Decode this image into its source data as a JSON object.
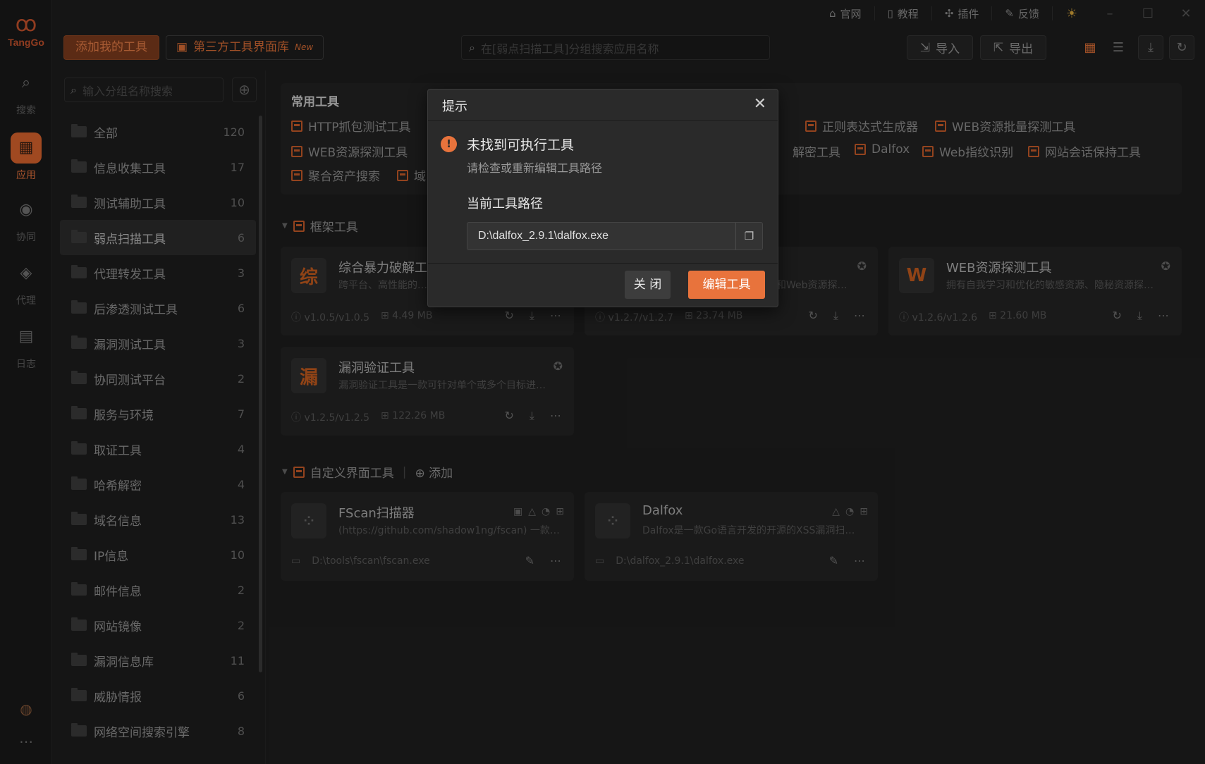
{
  "app": {
    "logo_text": "TangGo"
  },
  "rail": [
    {
      "label": "搜索",
      "icon": "search-icon"
    },
    {
      "label": "应用",
      "icon": "apps-icon",
      "active": true
    },
    {
      "label": "协同",
      "icon": "collab-icon"
    },
    {
      "label": "代理",
      "icon": "proxy-icon"
    },
    {
      "label": "日志",
      "icon": "log-icon"
    }
  ],
  "window": {
    "links": [
      "官网",
      "教程",
      "插件",
      "反馈"
    ]
  },
  "toolbar": {
    "add_tool": "添加我的工具",
    "third_party": "第三方工具界面库",
    "third_party_badge": "New",
    "search_placeholder": "在[弱点扫描工具]分组搜索应用名称",
    "import": "导入",
    "export": "导出"
  },
  "groups": {
    "search_placeholder": "输入分组名称搜索",
    "items": [
      {
        "name": "全部",
        "count": "120"
      },
      {
        "name": "信息收集工具",
        "count": "17"
      },
      {
        "name": "测试辅助工具",
        "count": "10"
      },
      {
        "name": "弱点扫描工具",
        "count": "6"
      },
      {
        "name": "代理转发工具",
        "count": "3"
      },
      {
        "name": "后渗透测试工具",
        "count": "6"
      },
      {
        "name": "漏洞测试工具",
        "count": "3"
      },
      {
        "name": "协同测试平台",
        "count": "2"
      },
      {
        "name": "服务与环境",
        "count": "7"
      },
      {
        "name": "取证工具",
        "count": "4"
      },
      {
        "name": "哈希解密",
        "count": "4"
      },
      {
        "name": "域名信息",
        "count": "13"
      },
      {
        "name": "IP信息",
        "count": "10"
      },
      {
        "name": "邮件信息",
        "count": "2"
      },
      {
        "name": "网站镜像",
        "count": "2"
      },
      {
        "name": "漏洞信息库",
        "count": "11"
      },
      {
        "name": "威胁情报",
        "count": "6"
      },
      {
        "name": "网络空间搜索引擎",
        "count": "8"
      }
    ]
  },
  "common": {
    "title": "常用工具",
    "links": [
      "HTTP抓包测试工具",
      "正则表达式生成器",
      "WEB资源批量探测工具",
      "WEB资源探测工具",
      "解密工具",
      "Dalfox",
      "Web指纹识别",
      "网站会话保持工具",
      "聚合资产搜索",
      "域"
    ]
  },
  "sections": {
    "framework": "框架工具",
    "custom": "自定义界面工具",
    "custom_add": "添加"
  },
  "cards": [
    {
      "icon_char": "综",
      "title": "综合暴力破解工具",
      "desc": "跨平台、高性能的…",
      "version": "v1.0.5/v1.0.5",
      "size": "4.49 MB"
    },
    {
      "icon_char": "",
      "title": "",
      "desc": "，和Web资源探…",
      "version": "v1.2.7/v1.2.7",
      "size": "23.74 MB"
    },
    {
      "icon_char": "W",
      "title": "WEB资源探测工具",
      "desc": "拥有自我学习和优化的敏感资源、隐秘资源探…",
      "version": "v1.2.6/v1.2.6",
      "size": "21.60 MB"
    },
    {
      "icon_char": "漏",
      "title": "漏洞验证工具",
      "desc": "漏洞验证工具是一款可针对单个或多个目标进…",
      "version": "v1.2.5/v1.2.5",
      "size": "122.26 MB"
    }
  ],
  "custom_cards": [
    {
      "title": "FScan扫描器",
      "desc": "(https://github.com/shadow1ng/fscan) 一款…",
      "path": "D:\\tools\\fscan\\fscan.exe"
    },
    {
      "title": "Dalfox",
      "desc": "Dalfox是一款Go语言开发的开源的XSS漏洞扫…",
      "path": "D:\\dalfox_2.9.1\\dalfox.exe"
    }
  ],
  "dialog": {
    "title": "提示",
    "message": "未找到可执行工具",
    "sub": "请检查或重新编辑工具路径",
    "path_label": "当前工具路径",
    "path_value": "D:\\dalfox_2.9.1\\dalfox.exe",
    "close": "关 闭",
    "edit": "编辑工具"
  },
  "colors": {
    "accent": "#e8733c",
    "bg": "#1d1d1d"
  }
}
